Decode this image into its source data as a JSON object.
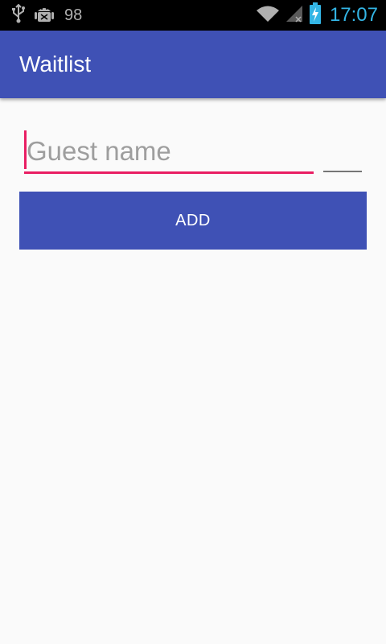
{
  "status_bar": {
    "notification_count": "98",
    "time": "17:07",
    "icons": [
      "usb-icon",
      "android-debug-icon",
      "wifi-icon",
      "signal-icon",
      "battery-charging-icon"
    ],
    "time_color": "#33b5e5"
  },
  "app_bar": {
    "title": "Waitlist",
    "color": "#3f51b5"
  },
  "form": {
    "guest_name_placeholder": "Guest name",
    "party_size_value": "",
    "add_label": "ADD",
    "accent_color": "#e91e63"
  }
}
